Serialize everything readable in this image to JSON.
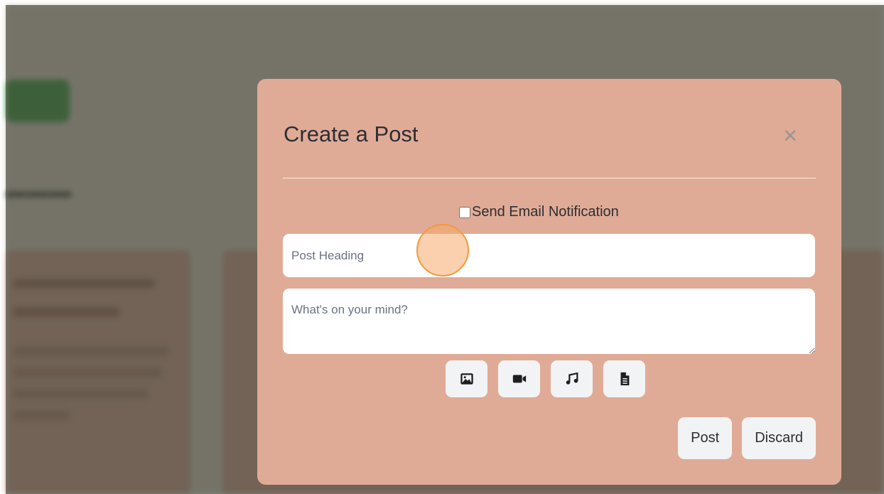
{
  "modal": {
    "title": "Create a Post",
    "close_symbol": "×",
    "notify_label": "Send Email Notification",
    "notify_checked": false,
    "heading_placeholder": "Post Heading",
    "body_placeholder": "What's on your mind?",
    "attachments": [
      {
        "icon": "image-icon"
      },
      {
        "icon": "video-icon"
      },
      {
        "icon": "music-icon"
      },
      {
        "icon": "file-icon"
      }
    ],
    "post_label": "Post",
    "discard_label": "Discard"
  },
  "colors": {
    "modal_bg": "#e0ab96",
    "button_bg": "#f2f3f5",
    "cursor_highlight": "#f29a3c"
  }
}
